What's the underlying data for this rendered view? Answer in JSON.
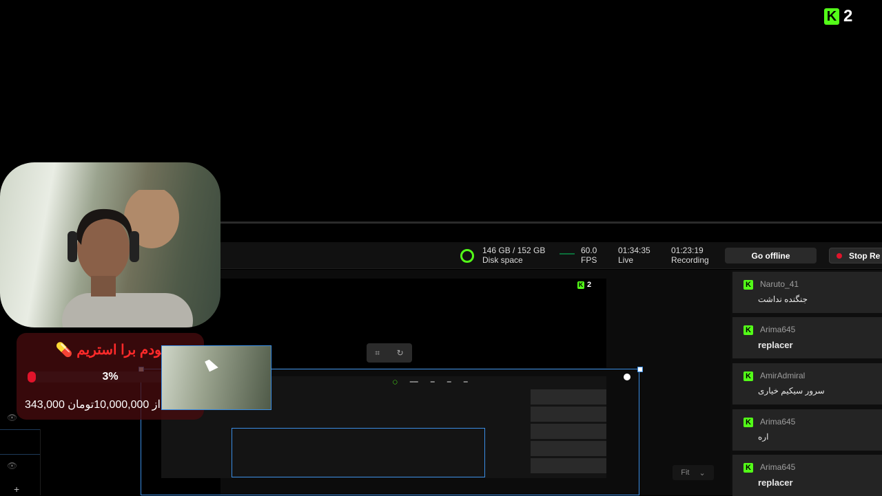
{
  "brand": {
    "logo": "K",
    "count": "2"
  },
  "stats": {
    "disk_value": "146 GB / 152 GB",
    "disk_label": "Disk space",
    "fps_value": "60.0",
    "fps_label": "FPS",
    "live_value": "01:34:35",
    "live_label": "Live",
    "rec_value": "01:23:19",
    "rec_label": "Recording"
  },
  "buttons": {
    "go_offline": "Go offline",
    "stop_recording": "Stop Re"
  },
  "preview": {
    "badge": "2",
    "fit_label": "Fit",
    "fit_icon": "chevron-down-icon",
    "crop_icon": "crop-icon",
    "rotate_icon": "rotate-icon"
  },
  "donation": {
    "title": "مودم برا استریم 💊",
    "percent": "3%",
    "progress_fraction": 0.03,
    "amount_text": "343,000 از 10,000,000تومان"
  },
  "chat": [
    {
      "user": "Naruto_41",
      "text": "جنگنده نداشت"
    },
    {
      "user": "Arima645",
      "text": "replacer"
    },
    {
      "user": "AmirAdmiral",
      "text": "سرور سیکیم خیاری"
    },
    {
      "user": "Arima645",
      "text": "اره"
    },
    {
      "user": "Arima645",
      "text": "replacer"
    }
  ],
  "colors": {
    "kick_green": "#53fc18",
    "selection_blue": "#3a8ee6",
    "record_red": "#e0142b"
  }
}
